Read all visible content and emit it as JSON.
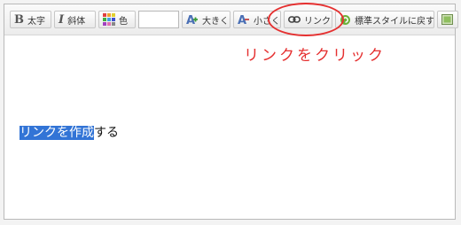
{
  "toolbar": {
    "bold_label": "太字",
    "italic_label": "斜体",
    "color_label": "色",
    "bigger_label": "大きく",
    "smaller_label": "小さく",
    "link_label": "リンク",
    "reset_style_label": "標準スタイルに戻す",
    "color_input_value": ""
  },
  "annotation": {
    "text": "リンクをクリック",
    "color": "#e53030"
  },
  "editor": {
    "selected_text": "リンクを作成",
    "rest_text": "する",
    "selection_color": "#3274d6"
  }
}
